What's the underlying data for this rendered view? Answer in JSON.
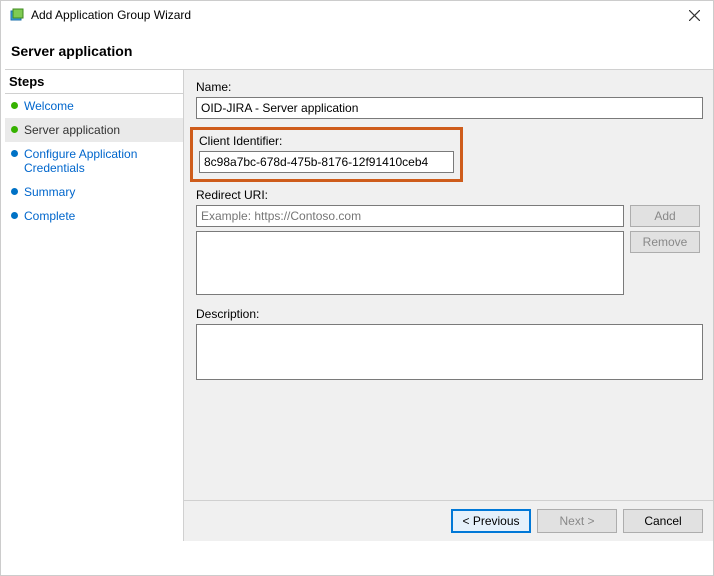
{
  "title": "Add Application Group Wizard",
  "page_heading": "Server application",
  "steps_header": "Steps",
  "steps": [
    {
      "label": "Welcome",
      "state": "done"
    },
    {
      "label": "Server application",
      "state": "current"
    },
    {
      "label": "Configure Application Credentials",
      "state": "pending"
    },
    {
      "label": "Summary",
      "state": "pending"
    },
    {
      "label": "Complete",
      "state": "pending"
    }
  ],
  "form": {
    "name_label": "Name:",
    "name_value": "OID-JIRA - Server application",
    "client_id_label": "Client Identifier:",
    "client_id_value": "8c98a7bc-678d-475b-8176-12f91410ceb4",
    "redirect_uri_label": "Redirect URI:",
    "redirect_uri_placeholder": "Example: https://Contoso.com",
    "add_btn": "Add",
    "remove_btn": "Remove",
    "description_label": "Description:"
  },
  "buttons": {
    "previous": "< Previous",
    "next": "Next >",
    "cancel": "Cancel"
  }
}
